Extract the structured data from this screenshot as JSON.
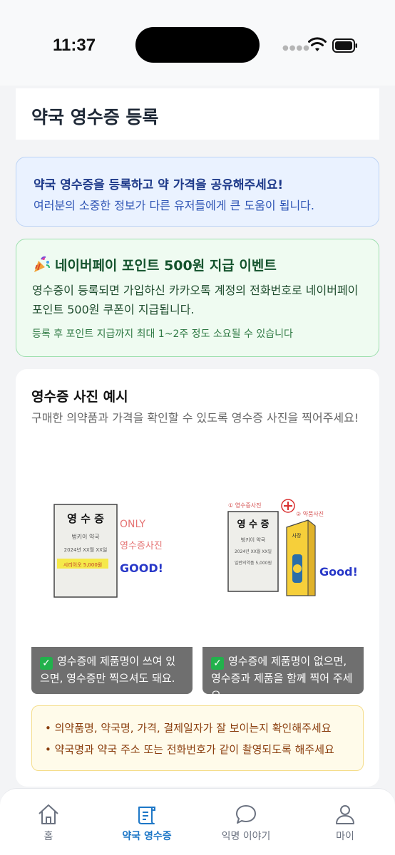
{
  "status": {
    "time": "11:37"
  },
  "header": {
    "title": "약국 영수증 등록"
  },
  "info": {
    "title": "약국 영수증을 등록하고 약 가격을 공유해주세요!",
    "body": "여러분의 소중한 정보가 다른 유저들에게 큰 도움이 됩니다."
  },
  "event": {
    "title": "네이버페이 포인트 500원 지급 이벤트",
    "body": "영수증이 등록되면 가입하신 카카오톡 계정의 전화번호로 네이버페이 포인트 500원 쿠폰이 지급됩니다.",
    "note": "등록 후 포인트 지급까지 최대 1~2주 정도 소요될 수 있습니다"
  },
  "example": {
    "title": "영수증 사진 예시",
    "description": "구매한 의약품과 가격을 확인할 수 있도록 영수증 사진을 찍어주세요!",
    "left_illustration": {
      "receipt_heading": "영 수 증",
      "receipt_line1": "벙키이 약국",
      "receipt_line2": "2024년 XX월 XX일",
      "receipt_highlight": "시리이오 5,000원",
      "note1": "ONLY",
      "note2": "영수증사진",
      "note3": "GOOD!"
    },
    "right_illustration": {
      "label1": "① 영수증사진",
      "label2": "② 약품사진",
      "receipt_heading": "영 수 증",
      "receipt_line1": "벙키이 약국",
      "receipt_line2": "2024년 XX월 XX일",
      "receipt_line3": "일반의약품 5,000원",
      "box_label": "사장",
      "note": "Good!"
    },
    "caption_left": "영수증에 제품명이 쓰여 있으면, 영수증만 찍으셔도 돼요.",
    "caption_right": "영수증에 제품명이 없으면, 영수증과 제품을 함께 찍어 주세요.",
    "tips": [
      "• 의약품명, 약국명, 가격, 결제일자가 잘 보이는지 확인해주세요",
      "• 약국명과 약국 주소 또는 전화번호가 같이 촬영되도록 해주세요"
    ]
  },
  "tabs": [
    {
      "label": "홈",
      "icon": "home-icon",
      "active": false
    },
    {
      "label": "약국 영수증",
      "icon": "receipt-icon",
      "active": true
    },
    {
      "label": "익명 이야기",
      "icon": "chat-icon",
      "active": false
    },
    {
      "label": "마이",
      "icon": "person-icon",
      "active": false
    }
  ],
  "colors": {
    "accent": "#1d77c7",
    "info_bg": "#eaf2ff",
    "event_bg": "#effbf1",
    "tip_bg": "#fffbea"
  }
}
